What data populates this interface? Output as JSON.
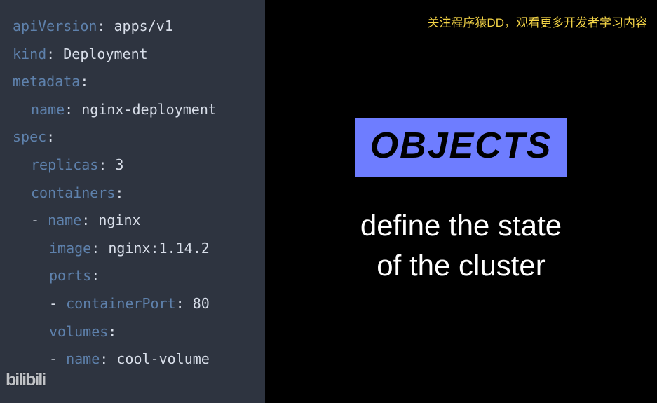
{
  "code": {
    "l1_key": "apiVersion",
    "l1_val": "apps/v1",
    "l2_key": "kind",
    "l2_val": "Deployment",
    "l3_key": "metadata",
    "l4_key": "name",
    "l4_val": "nginx-deployment",
    "l5_key": "spec",
    "l6_key": "replicas",
    "l6_val": "3",
    "l7_key": "containers",
    "l8_key": "name",
    "l8_val": "nginx",
    "l9_key": "image",
    "l9_val": "nginx:1.14.2",
    "l10_key": "ports",
    "l11_key": "containerPort",
    "l11_val": "80",
    "l12_key": "volumes",
    "l13_key": "name",
    "l13_val": "cool-volume"
  },
  "right": {
    "watermark": "关注程序猿DD，观看更多开发者学习内容",
    "heading": "OBJECTS",
    "subtitle_line1": "define the state",
    "subtitle_line2": "of the cluster"
  },
  "logo": "bilibili"
}
